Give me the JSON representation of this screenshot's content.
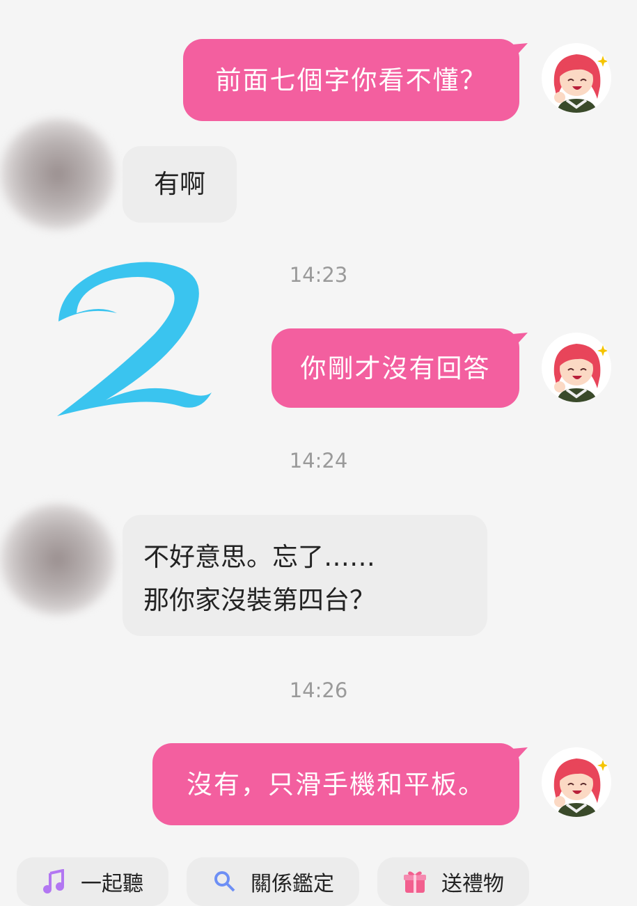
{
  "messages": {
    "m1": "前面七個字你看不懂？",
    "m2": "有啊",
    "m3": "你剛才沒有回答",
    "m4_line1": "不好意思。忘了……",
    "m4_line2": "那你家沒裝第四台？",
    "m5": "沒有，只滑手機和平板。"
  },
  "timestamps": {
    "t1": "14:23",
    "t2": "14:24",
    "t3": "14:26"
  },
  "overlay_number": "2",
  "actions": {
    "listen_together": "一起聽",
    "relationship_check": "關係鑑定",
    "send_gift": "送禮物"
  },
  "colors": {
    "outgoing_bubble": "#f35f9f",
    "incoming_bubble": "#ededed",
    "overlay_number": "#3ac4ef",
    "background": "#f5f5f5"
  },
  "icons": {
    "listen": "music-note-icon",
    "relationship": "magnifier-icon",
    "gift": "gift-icon"
  }
}
